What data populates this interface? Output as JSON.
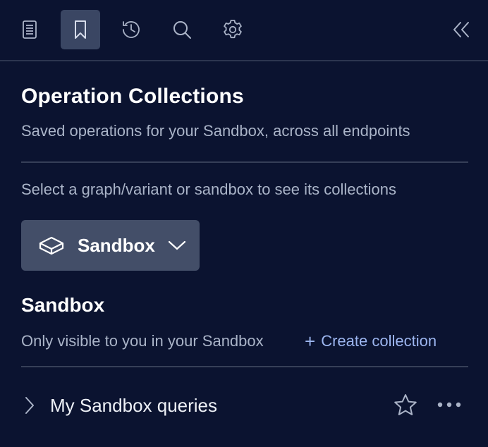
{
  "toolbar": {
    "items": [
      {
        "id": "docs",
        "icon": "document-icon",
        "active": false
      },
      {
        "id": "collections",
        "icon": "bookmark-icon",
        "active": true
      },
      {
        "id": "history",
        "icon": "history-icon",
        "active": false
      },
      {
        "id": "search",
        "icon": "search-icon",
        "active": false
      },
      {
        "id": "settings",
        "icon": "gear-icon",
        "active": false
      }
    ],
    "collapse_icon": "double-chevron-left-icon"
  },
  "header": {
    "title": "Operation Collections",
    "subtitle": "Saved operations for your Sandbox, across all endpoints"
  },
  "selector": {
    "hint": "Select a graph/variant or sandbox to see its collections",
    "selected": "Sandbox",
    "icon": "sandbox-cube-icon"
  },
  "section": {
    "title": "Sandbox",
    "subtitle": "Only visible to you in your Sandbox",
    "create_plus": "+",
    "create_label": "Create collection"
  },
  "collections": [
    {
      "name": "My Sandbox queries",
      "starred": false
    }
  ],
  "colors": {
    "background": "#0b1330",
    "active_tab": "#3a4663",
    "dropdown_bg": "#434e68",
    "link": "#9db6f0",
    "muted_text": "#aab4c8"
  }
}
